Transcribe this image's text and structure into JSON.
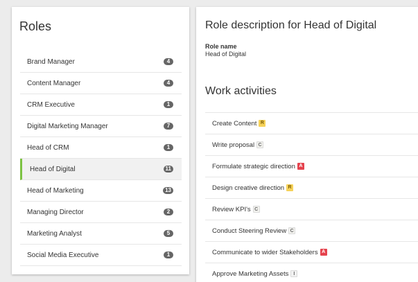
{
  "roles_panel": {
    "title": "Roles",
    "items": [
      {
        "label": "Brand Manager",
        "count": "4"
      },
      {
        "label": "Content Manager",
        "count": "4"
      },
      {
        "label": "CRM Executive",
        "count": "1"
      },
      {
        "label": "Digital Marketing Manager",
        "count": "7"
      },
      {
        "label": "Head of CRM",
        "count": "1"
      },
      {
        "label": "Head of Digital",
        "count": "11",
        "active": true
      },
      {
        "label": "Head of Marketing",
        "count": "13"
      },
      {
        "label": "Managing Director",
        "count": "2"
      },
      {
        "label": "Marketing Analyst",
        "count": "5"
      },
      {
        "label": "Social Media Executive",
        "count": "1"
      }
    ]
  },
  "detail": {
    "title": "Role description for Head of Digital",
    "role_name_label": "Role name",
    "role_name_value": "Head of Digital",
    "activities_title": "Work activities",
    "activities": [
      {
        "label": "Create Content",
        "badge": "R"
      },
      {
        "label": "Write proposal",
        "badge": "C"
      },
      {
        "label": "Formulate strategic direction",
        "badge": "A"
      },
      {
        "label": "Design creative direction",
        "badge": "R"
      },
      {
        "label": "Review KPI's",
        "badge": "C"
      },
      {
        "label": "Conduct Steering Review",
        "badge": "C"
      },
      {
        "label": "Communicate to wider Stakeholders",
        "badge": "A"
      },
      {
        "label": "Approve Marketing Assets",
        "badge": "I"
      }
    ]
  },
  "colors": {
    "active_accent": "#7cc242",
    "count_badge": "#666666",
    "badge_R": "#f6d25a",
    "badge_A": "#e5434e",
    "badge_C": "#f2f2ee",
    "badge_I": "#f2f2f2"
  }
}
